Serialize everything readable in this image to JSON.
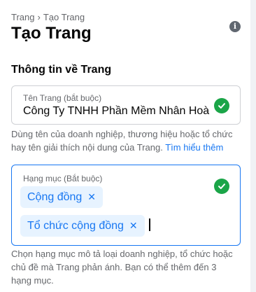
{
  "breadcrumb": {
    "parent": "Trang",
    "separator": "›",
    "current": "Tạo Trang"
  },
  "header": {
    "title": "Tạo Trang",
    "info_icon": "info-icon"
  },
  "section": {
    "title": "Thông tin về Trang"
  },
  "page_name": {
    "label": "Tên Trang (bắt buộc)",
    "value": "Công Ty TNHH Phần Mềm Nhân Hoà",
    "status_icon": "check-circle-icon",
    "helper": "Dùng tên của doanh nghiệp, thương hiệu hoặc tổ chức hay tên giải thích nội dung của Trang.",
    "helper_link": "Tìm hiểu thêm"
  },
  "category": {
    "label": "Hạng mục (Bắt buộc)",
    "status_icon": "check-circle-icon",
    "chips": [
      {
        "label": "Cộng đồng",
        "remove_icon": "close-icon"
      },
      {
        "label": "Tổ chức cộng đồng",
        "remove_icon": "close-icon"
      }
    ],
    "helper": "Chọn hạng mục mô tả loại doanh nghiệp, tổ chức hoặc chủ đề mà Trang phản ánh. Bạn có thể thêm đến 3 hạng mục."
  },
  "colors": {
    "accent": "#1877f2",
    "success": "#1ba548",
    "chip_bg": "#e7f3ff",
    "muted": "#65676b"
  }
}
